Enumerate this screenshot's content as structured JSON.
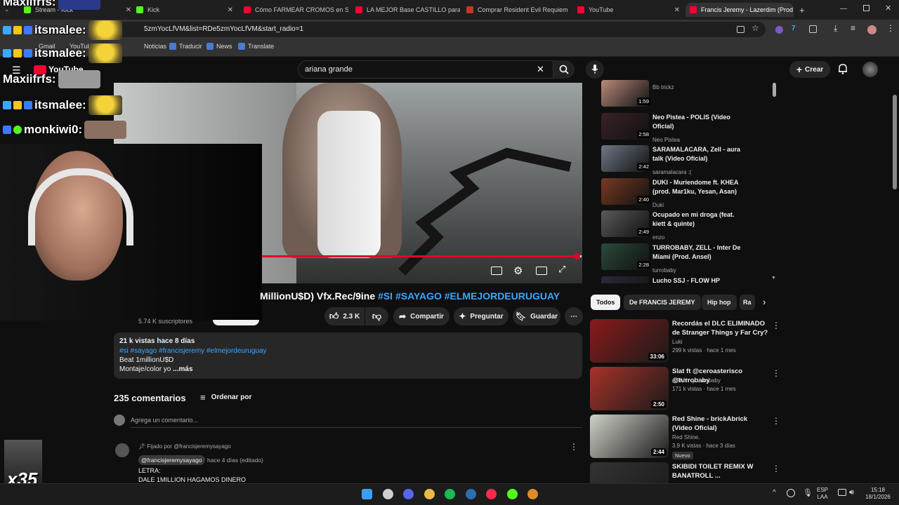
{
  "browser": {
    "tabs": [
      {
        "label": "Stream - Kick",
        "color": "#53fc18"
      },
      {
        "label": "Kick",
        "color": "#53fc18"
      },
      {
        "label": "Cómo FARMEAR CROMOS en S",
        "color": "#ff0033"
      },
      {
        "label": "LA MEJOR Base CASTILLO para",
        "color": "#ff0033"
      },
      {
        "label": "Comprar Resident Evil Requiem",
        "color": "#c0392b"
      },
      {
        "label": "YouTube",
        "color": "#ff0033"
      },
      {
        "label": "Francis Jeremy - Lazerdim (Prod",
        "color": "#ff0033"
      }
    ],
    "new_tab": "+",
    "url": "5zmYocLfVM&list=RDe5zmYocLfVM&start_radio=1",
    "bookmarks": [
      "Gmail",
      "YouTube",
      "Noticias",
      "Traducir",
      "News",
      "Translate"
    ]
  },
  "overlay": {
    "chat": [
      {
        "user": "Maxiifrfs:"
      },
      {
        "user": "itsmalee:"
      },
      {
        "user": "itsmalee:"
      },
      {
        "user": "Maxiifrfs:"
      },
      {
        "user": "itsmalee:"
      },
      {
        "user": "monkiwi0:"
      }
    ],
    "multiplier": "x35"
  },
  "youtube": {
    "logo": "YouTube",
    "search_value": "ariana grande",
    "create_label": "Crear",
    "video": {
      "title_prefix": "MillionU$D) Vfx.Rec/9ine",
      "hashtags": "#SI #SAYAGO #ELMEJORDEURUGUAY",
      "subscribers": "5.74 K suscriptores",
      "likes": "2.3 K",
      "share": "Compartir",
      "ask": "Preguntar",
      "save": "Guardar",
      "progress": 0.99
    },
    "description": {
      "stats": "21 k vistas  hace 8 días",
      "tags": "#si #sayago #francisjeremy #elmejordeuruguay",
      "line1": "Beat 1millionU$D",
      "line2": "Montaje/color yo",
      "more": "...más"
    },
    "comments": {
      "title": "235 comentarios",
      "sort": "Ordenar por",
      "add_placeholder": "Agrega un comentario...",
      "pinned": "Fijado por @francisjeremysayago",
      "author": "@francisjeremysayago",
      "time": "hace 4 días (editado)",
      "text1": "LETRA:",
      "text2": "DALE 1MILLION HAGAMOS DINERO"
    },
    "playlist": [
      {
        "title": "",
        "channel": "Bb trickz",
        "duration": "1:59",
        "color": "#b98a7a"
      },
      {
        "title": "Neo Pistea - POLIS (Video Oficial)",
        "channel": "Neo Pistea",
        "duration": "2:58",
        "color": "#3a2226"
      },
      {
        "title": "SARAMALACARA, Zell - aura talk (Video Oficial)",
        "channel": "saramalacara :(",
        "duration": "2:42",
        "color": "#6f7884"
      },
      {
        "title": "DUKI - Muriendome ft. KHEA (prod. Mar1ku, Yesan, Asan)",
        "channel": "Duki",
        "duration": "2:40",
        "color": "#7a3a22"
      },
      {
        "title": "Ocupado en mi droga (feat. kiett & quinte)",
        "channel": "enzo",
        "duration": "2:49",
        "color": "#5a5a5a"
      },
      {
        "title": "TURROBABY, ZELL - Inter De Miami (Prod. Ansel)",
        "channel": "turrobaby",
        "duration": "2:28",
        "color": "#2a4a3a"
      },
      {
        "title": "Lucho SSJ - FLOW HP (VIDEOCLIP OFICIAL)",
        "channel": "",
        "duration": "",
        "color": "#2a2a3a"
      }
    ],
    "chips": [
      "Todos",
      "De FRANCIS JEREMY",
      "Hip hop",
      "Ra"
    ],
    "recommended": [
      {
        "title": "Recordás el DLC ELIMINADO de Stranger Things y Far Cry?",
        "channel": "Luki",
        "meta": "299 k vistas · hace 1 mes",
        "duration": "33:06",
        "badge": "",
        "color": "#8a1a1a"
      },
      {
        "title": "Slat ft @ceroasterisco @turrobaby",
        "channel": "ASAN · y turrobaby",
        "meta": "171 k vistas · hace 1 mes",
        "duration": "2:50",
        "badge": "",
        "color": "#a8322a"
      },
      {
        "title": "Red Shine - brickAbrick (Video Oficial)",
        "channel": "Red Shine.",
        "meta": "3.9 K vistas · hace 3 días",
        "duration": "2:44",
        "badge": "Nuevo",
        "color": "#cfd2c8"
      },
      {
        "title": "SKIBIDI TOILET REMIX W BANATROLL ...",
        "channel": "",
        "meta": "",
        "duration": "",
        "badge": "",
        "color": "#333333"
      }
    ]
  },
  "taskbar": {
    "lang1": "ESP",
    "lang2": "LAA",
    "time": "15:18",
    "date": "18/1/2026"
  }
}
